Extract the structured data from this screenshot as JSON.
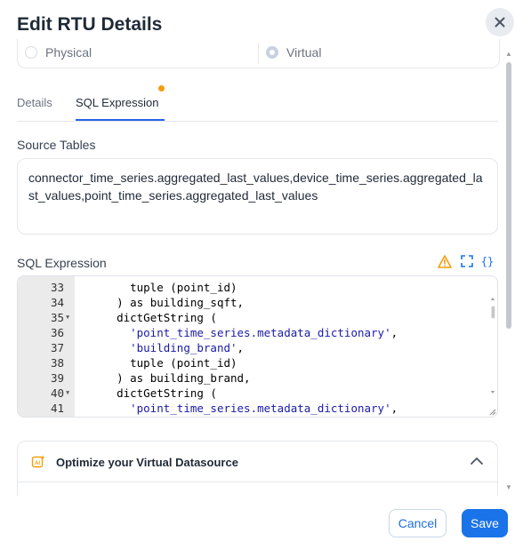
{
  "dialog": {
    "title": "Edit RTU Details"
  },
  "source_type": {
    "options": [
      {
        "label": "Physical",
        "selected": false
      },
      {
        "label": "Virtual",
        "selected": true
      }
    ]
  },
  "tabs": [
    {
      "label": "Details",
      "active": false
    },
    {
      "label": "SQL Expression",
      "active": true,
      "has_notification_dot": true
    }
  ],
  "source_tables": {
    "label": "Source Tables",
    "value": "connector_time_series.aggregated_last_values,device_time_series.aggregated_last_values,point_time_series.aggregated_last_values"
  },
  "sql_expression": {
    "label": "SQL Expression",
    "icons": [
      "warning-icon",
      "expand-icon",
      "format-braces-icon"
    ],
    "lines": [
      {
        "num": "33",
        "fold": false,
        "indent": "    ",
        "code": "tuple (point_id)",
        "is_string": false
      },
      {
        "num": "34",
        "fold": false,
        "indent": "  ",
        "code": ") as building_sqft,",
        "is_string": false
      },
      {
        "num": "35",
        "fold": true,
        "indent": "  ",
        "code": "dictGetString (",
        "is_string": false
      },
      {
        "num": "36",
        "fold": false,
        "indent": "    ",
        "code": "'point_time_series.metadata_dictionary'",
        "suffix": ",",
        "is_string": true
      },
      {
        "num": "37",
        "fold": false,
        "indent": "    ",
        "code": "'building_brand'",
        "suffix": ",",
        "is_string": true
      },
      {
        "num": "38",
        "fold": false,
        "indent": "    ",
        "code": "tuple (point_id)",
        "is_string": false
      },
      {
        "num": "39",
        "fold": false,
        "indent": "  ",
        "code": ") as building_brand,",
        "is_string": false
      },
      {
        "num": "40",
        "fold": true,
        "indent": "  ",
        "code": "dictGetString (",
        "is_string": false
      },
      {
        "num": "41",
        "fold": false,
        "indent": "    ",
        "code": "'point_time_series.metadata_dictionary'",
        "suffix": ",",
        "is_string": true
      }
    ]
  },
  "optimize": {
    "title": "Optimize your Virtual Datasource",
    "expanded": true
  },
  "footer": {
    "cancel_label": "Cancel",
    "save_label": "Save"
  },
  "colors": {
    "primary": "#1a73e8",
    "warning": "#f59e0b",
    "tab_dot": "#f59e0b"
  }
}
